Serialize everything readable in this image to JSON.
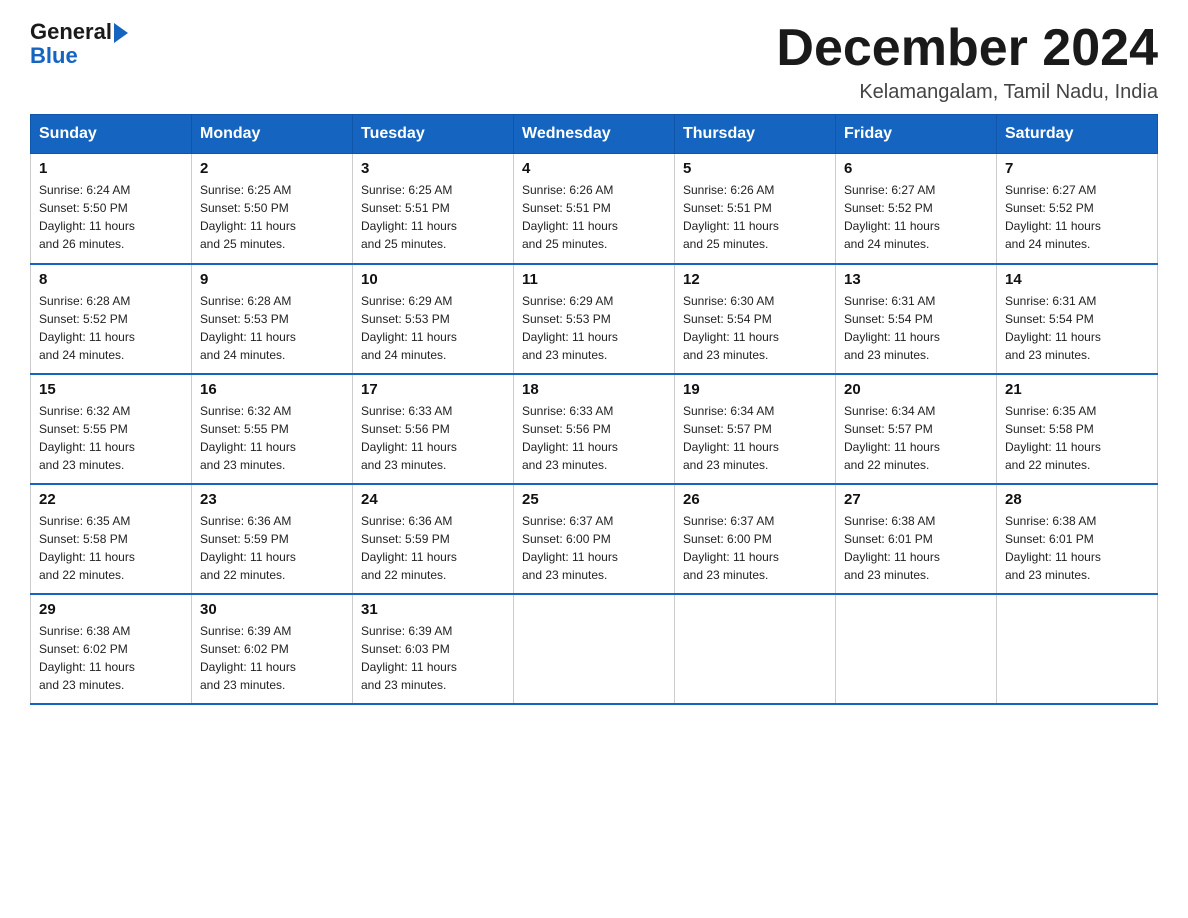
{
  "logo": {
    "text_general": "General",
    "text_blue": "Blue",
    "arrow": "▶"
  },
  "header": {
    "month_title": "December 2024",
    "location": "Kelamangalam, Tamil Nadu, India"
  },
  "days_of_week": [
    "Sunday",
    "Monday",
    "Tuesday",
    "Wednesday",
    "Thursday",
    "Friday",
    "Saturday"
  ],
  "weeks": [
    [
      {
        "day": "1",
        "sunrise": "6:24 AM",
        "sunset": "5:50 PM",
        "daylight": "11 hours and 26 minutes."
      },
      {
        "day": "2",
        "sunrise": "6:25 AM",
        "sunset": "5:50 PM",
        "daylight": "11 hours and 25 minutes."
      },
      {
        "day": "3",
        "sunrise": "6:25 AM",
        "sunset": "5:51 PM",
        "daylight": "11 hours and 25 minutes."
      },
      {
        "day": "4",
        "sunrise": "6:26 AM",
        "sunset": "5:51 PM",
        "daylight": "11 hours and 25 minutes."
      },
      {
        "day": "5",
        "sunrise": "6:26 AM",
        "sunset": "5:51 PM",
        "daylight": "11 hours and 25 minutes."
      },
      {
        "day": "6",
        "sunrise": "6:27 AM",
        "sunset": "5:52 PM",
        "daylight": "11 hours and 24 minutes."
      },
      {
        "day": "7",
        "sunrise": "6:27 AM",
        "sunset": "5:52 PM",
        "daylight": "11 hours and 24 minutes."
      }
    ],
    [
      {
        "day": "8",
        "sunrise": "6:28 AM",
        "sunset": "5:52 PM",
        "daylight": "11 hours and 24 minutes."
      },
      {
        "day": "9",
        "sunrise": "6:28 AM",
        "sunset": "5:53 PM",
        "daylight": "11 hours and 24 minutes."
      },
      {
        "day": "10",
        "sunrise": "6:29 AM",
        "sunset": "5:53 PM",
        "daylight": "11 hours and 24 minutes."
      },
      {
        "day": "11",
        "sunrise": "6:29 AM",
        "sunset": "5:53 PM",
        "daylight": "11 hours and 23 minutes."
      },
      {
        "day": "12",
        "sunrise": "6:30 AM",
        "sunset": "5:54 PM",
        "daylight": "11 hours and 23 minutes."
      },
      {
        "day": "13",
        "sunrise": "6:31 AM",
        "sunset": "5:54 PM",
        "daylight": "11 hours and 23 minutes."
      },
      {
        "day": "14",
        "sunrise": "6:31 AM",
        "sunset": "5:54 PM",
        "daylight": "11 hours and 23 minutes."
      }
    ],
    [
      {
        "day": "15",
        "sunrise": "6:32 AM",
        "sunset": "5:55 PM",
        "daylight": "11 hours and 23 minutes."
      },
      {
        "day": "16",
        "sunrise": "6:32 AM",
        "sunset": "5:55 PM",
        "daylight": "11 hours and 23 minutes."
      },
      {
        "day": "17",
        "sunrise": "6:33 AM",
        "sunset": "5:56 PM",
        "daylight": "11 hours and 23 minutes."
      },
      {
        "day": "18",
        "sunrise": "6:33 AM",
        "sunset": "5:56 PM",
        "daylight": "11 hours and 23 minutes."
      },
      {
        "day": "19",
        "sunrise": "6:34 AM",
        "sunset": "5:57 PM",
        "daylight": "11 hours and 23 minutes."
      },
      {
        "day": "20",
        "sunrise": "6:34 AM",
        "sunset": "5:57 PM",
        "daylight": "11 hours and 22 minutes."
      },
      {
        "day": "21",
        "sunrise": "6:35 AM",
        "sunset": "5:58 PM",
        "daylight": "11 hours and 22 minutes."
      }
    ],
    [
      {
        "day": "22",
        "sunrise": "6:35 AM",
        "sunset": "5:58 PM",
        "daylight": "11 hours and 22 minutes."
      },
      {
        "day": "23",
        "sunrise": "6:36 AM",
        "sunset": "5:59 PM",
        "daylight": "11 hours and 22 minutes."
      },
      {
        "day": "24",
        "sunrise": "6:36 AM",
        "sunset": "5:59 PM",
        "daylight": "11 hours and 22 minutes."
      },
      {
        "day": "25",
        "sunrise": "6:37 AM",
        "sunset": "6:00 PM",
        "daylight": "11 hours and 23 minutes."
      },
      {
        "day": "26",
        "sunrise": "6:37 AM",
        "sunset": "6:00 PM",
        "daylight": "11 hours and 23 minutes."
      },
      {
        "day": "27",
        "sunrise": "6:38 AM",
        "sunset": "6:01 PM",
        "daylight": "11 hours and 23 minutes."
      },
      {
        "day": "28",
        "sunrise": "6:38 AM",
        "sunset": "6:01 PM",
        "daylight": "11 hours and 23 minutes."
      }
    ],
    [
      {
        "day": "29",
        "sunrise": "6:38 AM",
        "sunset": "6:02 PM",
        "daylight": "11 hours and 23 minutes."
      },
      {
        "day": "30",
        "sunrise": "6:39 AM",
        "sunset": "6:02 PM",
        "daylight": "11 hours and 23 minutes."
      },
      {
        "day": "31",
        "sunrise": "6:39 AM",
        "sunset": "6:03 PM",
        "daylight": "11 hours and 23 minutes."
      },
      null,
      null,
      null,
      null
    ]
  ],
  "labels": {
    "sunrise": "Sunrise:",
    "sunset": "Sunset:",
    "daylight": "Daylight:"
  }
}
